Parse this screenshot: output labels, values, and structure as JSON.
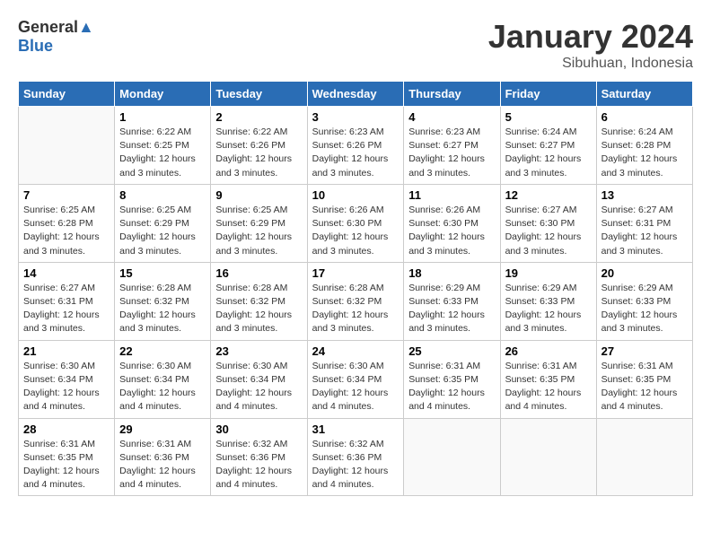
{
  "header": {
    "logo_general": "General",
    "logo_blue": "Blue",
    "month": "January 2024",
    "location": "Sibuhuan, Indonesia"
  },
  "weekdays": [
    "Sunday",
    "Monday",
    "Tuesday",
    "Wednesday",
    "Thursday",
    "Friday",
    "Saturday"
  ],
  "weeks": [
    [
      {
        "day": "",
        "sunrise": "",
        "sunset": "",
        "daylight": ""
      },
      {
        "day": "1",
        "sunrise": "Sunrise: 6:22 AM",
        "sunset": "Sunset: 6:25 PM",
        "daylight": "Daylight: 12 hours and 3 minutes."
      },
      {
        "day": "2",
        "sunrise": "Sunrise: 6:22 AM",
        "sunset": "Sunset: 6:26 PM",
        "daylight": "Daylight: 12 hours and 3 minutes."
      },
      {
        "day": "3",
        "sunrise": "Sunrise: 6:23 AM",
        "sunset": "Sunset: 6:26 PM",
        "daylight": "Daylight: 12 hours and 3 minutes."
      },
      {
        "day": "4",
        "sunrise": "Sunrise: 6:23 AM",
        "sunset": "Sunset: 6:27 PM",
        "daylight": "Daylight: 12 hours and 3 minutes."
      },
      {
        "day": "5",
        "sunrise": "Sunrise: 6:24 AM",
        "sunset": "Sunset: 6:27 PM",
        "daylight": "Daylight: 12 hours and 3 minutes."
      },
      {
        "day": "6",
        "sunrise": "Sunrise: 6:24 AM",
        "sunset": "Sunset: 6:28 PM",
        "daylight": "Daylight: 12 hours and 3 minutes."
      }
    ],
    [
      {
        "day": "7",
        "sunrise": "Sunrise: 6:25 AM",
        "sunset": "Sunset: 6:28 PM",
        "daylight": "Daylight: 12 hours and 3 minutes."
      },
      {
        "day": "8",
        "sunrise": "Sunrise: 6:25 AM",
        "sunset": "Sunset: 6:29 PM",
        "daylight": "Daylight: 12 hours and 3 minutes."
      },
      {
        "day": "9",
        "sunrise": "Sunrise: 6:25 AM",
        "sunset": "Sunset: 6:29 PM",
        "daylight": "Daylight: 12 hours and 3 minutes."
      },
      {
        "day": "10",
        "sunrise": "Sunrise: 6:26 AM",
        "sunset": "Sunset: 6:30 PM",
        "daylight": "Daylight: 12 hours and 3 minutes."
      },
      {
        "day": "11",
        "sunrise": "Sunrise: 6:26 AM",
        "sunset": "Sunset: 6:30 PM",
        "daylight": "Daylight: 12 hours and 3 minutes."
      },
      {
        "day": "12",
        "sunrise": "Sunrise: 6:27 AM",
        "sunset": "Sunset: 6:30 PM",
        "daylight": "Daylight: 12 hours and 3 minutes."
      },
      {
        "day": "13",
        "sunrise": "Sunrise: 6:27 AM",
        "sunset": "Sunset: 6:31 PM",
        "daylight": "Daylight: 12 hours and 3 minutes."
      }
    ],
    [
      {
        "day": "14",
        "sunrise": "Sunrise: 6:27 AM",
        "sunset": "Sunset: 6:31 PM",
        "daylight": "Daylight: 12 hours and 3 minutes."
      },
      {
        "day": "15",
        "sunrise": "Sunrise: 6:28 AM",
        "sunset": "Sunset: 6:32 PM",
        "daylight": "Daylight: 12 hours and 3 minutes."
      },
      {
        "day": "16",
        "sunrise": "Sunrise: 6:28 AM",
        "sunset": "Sunset: 6:32 PM",
        "daylight": "Daylight: 12 hours and 3 minutes."
      },
      {
        "day": "17",
        "sunrise": "Sunrise: 6:28 AM",
        "sunset": "Sunset: 6:32 PM",
        "daylight": "Daylight: 12 hours and 3 minutes."
      },
      {
        "day": "18",
        "sunrise": "Sunrise: 6:29 AM",
        "sunset": "Sunset: 6:33 PM",
        "daylight": "Daylight: 12 hours and 3 minutes."
      },
      {
        "day": "19",
        "sunrise": "Sunrise: 6:29 AM",
        "sunset": "Sunset: 6:33 PM",
        "daylight": "Daylight: 12 hours and 3 minutes."
      },
      {
        "day": "20",
        "sunrise": "Sunrise: 6:29 AM",
        "sunset": "Sunset: 6:33 PM",
        "daylight": "Daylight: 12 hours and 3 minutes."
      }
    ],
    [
      {
        "day": "21",
        "sunrise": "Sunrise: 6:30 AM",
        "sunset": "Sunset: 6:34 PM",
        "daylight": "Daylight: 12 hours and 4 minutes."
      },
      {
        "day": "22",
        "sunrise": "Sunrise: 6:30 AM",
        "sunset": "Sunset: 6:34 PM",
        "daylight": "Daylight: 12 hours and 4 minutes."
      },
      {
        "day": "23",
        "sunrise": "Sunrise: 6:30 AM",
        "sunset": "Sunset: 6:34 PM",
        "daylight": "Daylight: 12 hours and 4 minutes."
      },
      {
        "day": "24",
        "sunrise": "Sunrise: 6:30 AM",
        "sunset": "Sunset: 6:34 PM",
        "daylight": "Daylight: 12 hours and 4 minutes."
      },
      {
        "day": "25",
        "sunrise": "Sunrise: 6:31 AM",
        "sunset": "Sunset: 6:35 PM",
        "daylight": "Daylight: 12 hours and 4 minutes."
      },
      {
        "day": "26",
        "sunrise": "Sunrise: 6:31 AM",
        "sunset": "Sunset: 6:35 PM",
        "daylight": "Daylight: 12 hours and 4 minutes."
      },
      {
        "day": "27",
        "sunrise": "Sunrise: 6:31 AM",
        "sunset": "Sunset: 6:35 PM",
        "daylight": "Daylight: 12 hours and 4 minutes."
      }
    ],
    [
      {
        "day": "28",
        "sunrise": "Sunrise: 6:31 AM",
        "sunset": "Sunset: 6:35 PM",
        "daylight": "Daylight: 12 hours and 4 minutes."
      },
      {
        "day": "29",
        "sunrise": "Sunrise: 6:31 AM",
        "sunset": "Sunset: 6:36 PM",
        "daylight": "Daylight: 12 hours and 4 minutes."
      },
      {
        "day": "30",
        "sunrise": "Sunrise: 6:32 AM",
        "sunset": "Sunset: 6:36 PM",
        "daylight": "Daylight: 12 hours and 4 minutes."
      },
      {
        "day": "31",
        "sunrise": "Sunrise: 6:32 AM",
        "sunset": "Sunset: 6:36 PM",
        "daylight": "Daylight: 12 hours and 4 minutes."
      },
      {
        "day": "",
        "sunrise": "",
        "sunset": "",
        "daylight": ""
      },
      {
        "day": "",
        "sunrise": "",
        "sunset": "",
        "daylight": ""
      },
      {
        "day": "",
        "sunrise": "",
        "sunset": "",
        "daylight": ""
      }
    ]
  ]
}
